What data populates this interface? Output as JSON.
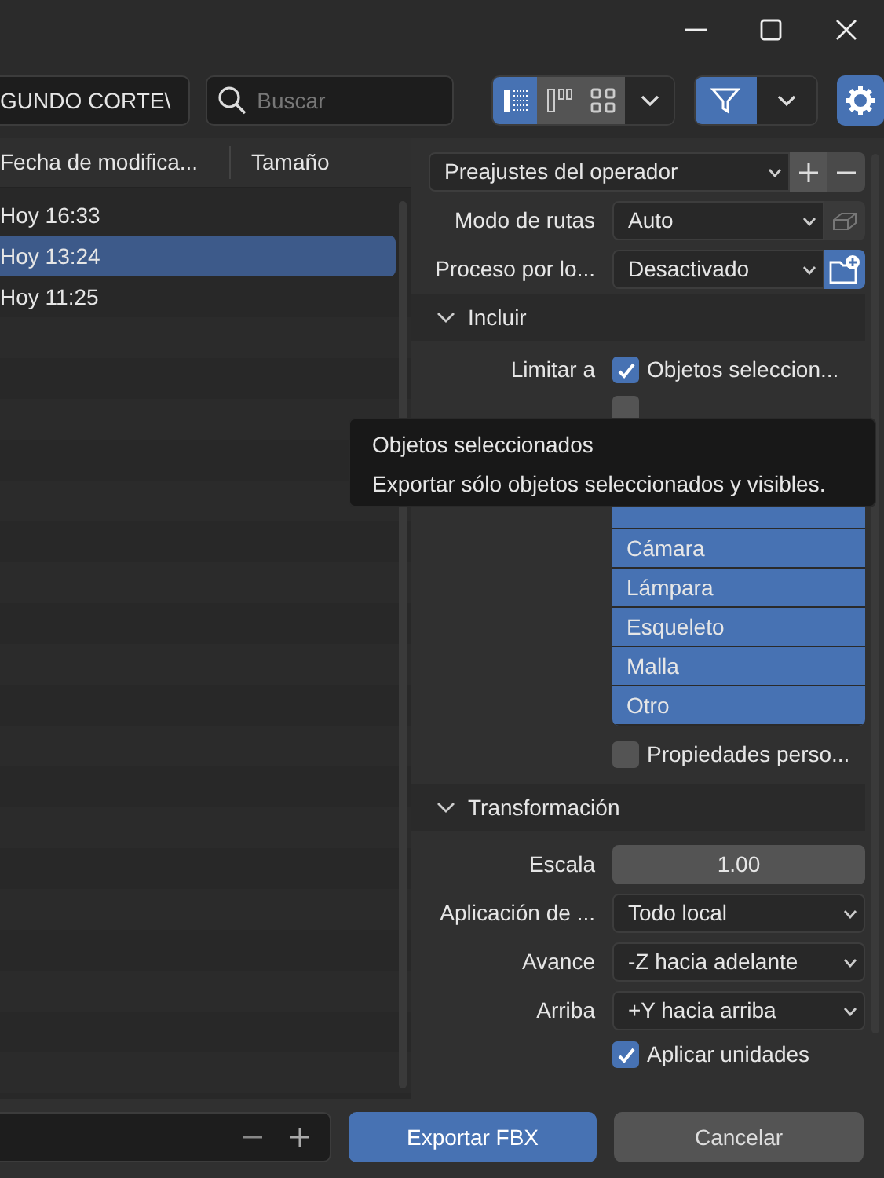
{
  "toolbar": {
    "path": "GUNDO CORTE\\",
    "search": {
      "placeholder": "Buscar"
    },
    "view_modes": [
      {
        "selected": true
      },
      {
        "selected": false
      },
      {
        "selected": false
      }
    ],
    "filter": {
      "on": true
    }
  },
  "file_list": {
    "columns": [
      "Fecha de modifica...",
      "Tamaño"
    ],
    "rows": [
      {
        "date": "Hoy 16:33",
        "selected": false
      },
      {
        "date": "Hoy 13:24",
        "selected": true
      },
      {
        "date": "Hoy 11:25",
        "selected": false
      }
    ]
  },
  "presets": {
    "label": "Preajustes del operador"
  },
  "top_rows": [
    {
      "label": "Modo de rutas",
      "value": "Auto",
      "side_button_on": false
    },
    {
      "label": "Proceso por lo...",
      "value": "Desactivado",
      "side_button_on": true
    }
  ],
  "sections": [
    {
      "title": "Incluir",
      "expanded": true,
      "rows": [
        {
          "kind": "checkbox",
          "label": "Limitar a",
          "text": "Objetos seleccion...",
          "checked": true
        },
        {
          "kind": "checkbox",
          "checked": false
        },
        {
          "kind": "list",
          "items": [
            {
              "selected": true
            },
            {
              "text": "Cámara",
              "selected": true
            },
            {
              "text": "Lámpara",
              "selected": true
            },
            {
              "text": "Esqueleto",
              "selected": true
            },
            {
              "text": "Malla",
              "selected": true
            },
            {
              "text": "Otro",
              "selected": true
            }
          ]
        },
        {
          "kind": "checkbox",
          "text": "Propiedades perso...",
          "checked": false
        }
      ]
    },
    {
      "title": "Transformación",
      "expanded": true,
      "rows": [
        {
          "kind": "number",
          "label": "Escala",
          "value": "1.00"
        },
        {
          "kind": "select",
          "label": "Aplicación de ...",
          "value": "Todo local"
        },
        {
          "kind": "select",
          "label": "Avance",
          "value": "-Z hacia adelante"
        },
        {
          "kind": "select",
          "label": "Arriba",
          "value": "+Y hacia arriba"
        },
        {
          "kind": "checkbox",
          "text": "Aplicar unidades",
          "checked": true
        }
      ]
    }
  ],
  "tooltip": {
    "title": "Objetos seleccionados",
    "text": "Exportar sólo objetos seleccionados y visibles."
  },
  "footer": {
    "export_button": "Exportar FBX",
    "cancel_button": "Cancelar"
  }
}
